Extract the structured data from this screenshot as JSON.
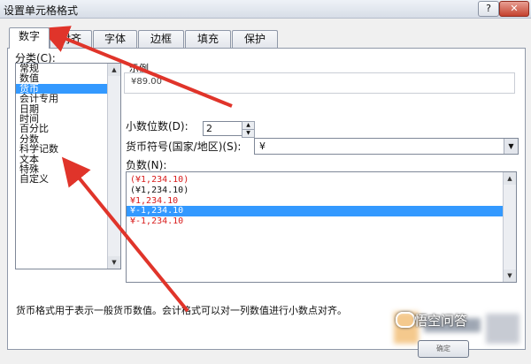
{
  "window": {
    "title": "设置单元格格式",
    "help_label": "?",
    "close_label": "✕"
  },
  "tabs": [
    {
      "label": "数字",
      "active": true
    },
    {
      "label": "对齐"
    },
    {
      "label": "字体"
    },
    {
      "label": "边框"
    },
    {
      "label": "填充"
    },
    {
      "label": "保护"
    }
  ],
  "category": {
    "label": "分类(C):",
    "items": [
      "常规",
      "数值",
      "货币",
      "会计专用",
      "日期",
      "时间",
      "百分比",
      "分数",
      "科学记数",
      "文本",
      "特殊",
      "自定义"
    ],
    "selected_index": 2
  },
  "sample": {
    "label": "示例",
    "value": "¥89.00"
  },
  "decimal": {
    "label": "小数位数(D):",
    "value": "2"
  },
  "currency_symbol": {
    "label": "货币符号(国家/地区)(S):",
    "value": "¥"
  },
  "negative": {
    "label": "负数(N):",
    "items": [
      {
        "text": "(¥1,234.10)",
        "red": true
      },
      {
        "text": "(¥1,234.10)",
        "red": false
      },
      {
        "text": "¥1,234.10",
        "red": true
      },
      {
        "text": "¥-1,234.10",
        "red": false,
        "selected": true
      },
      {
        "text": "¥-1,234.10",
        "red": true
      }
    ]
  },
  "description": "货币格式用于表示一般货币数值。会计格式可以对一列数值进行小数点对齐。",
  "watermark": "悟空问答",
  "ok_label": "确定",
  "colors": {
    "accent_select": "#3399ff",
    "negative_red": "#d81c1c",
    "annotation_arrow": "#e0342a"
  }
}
